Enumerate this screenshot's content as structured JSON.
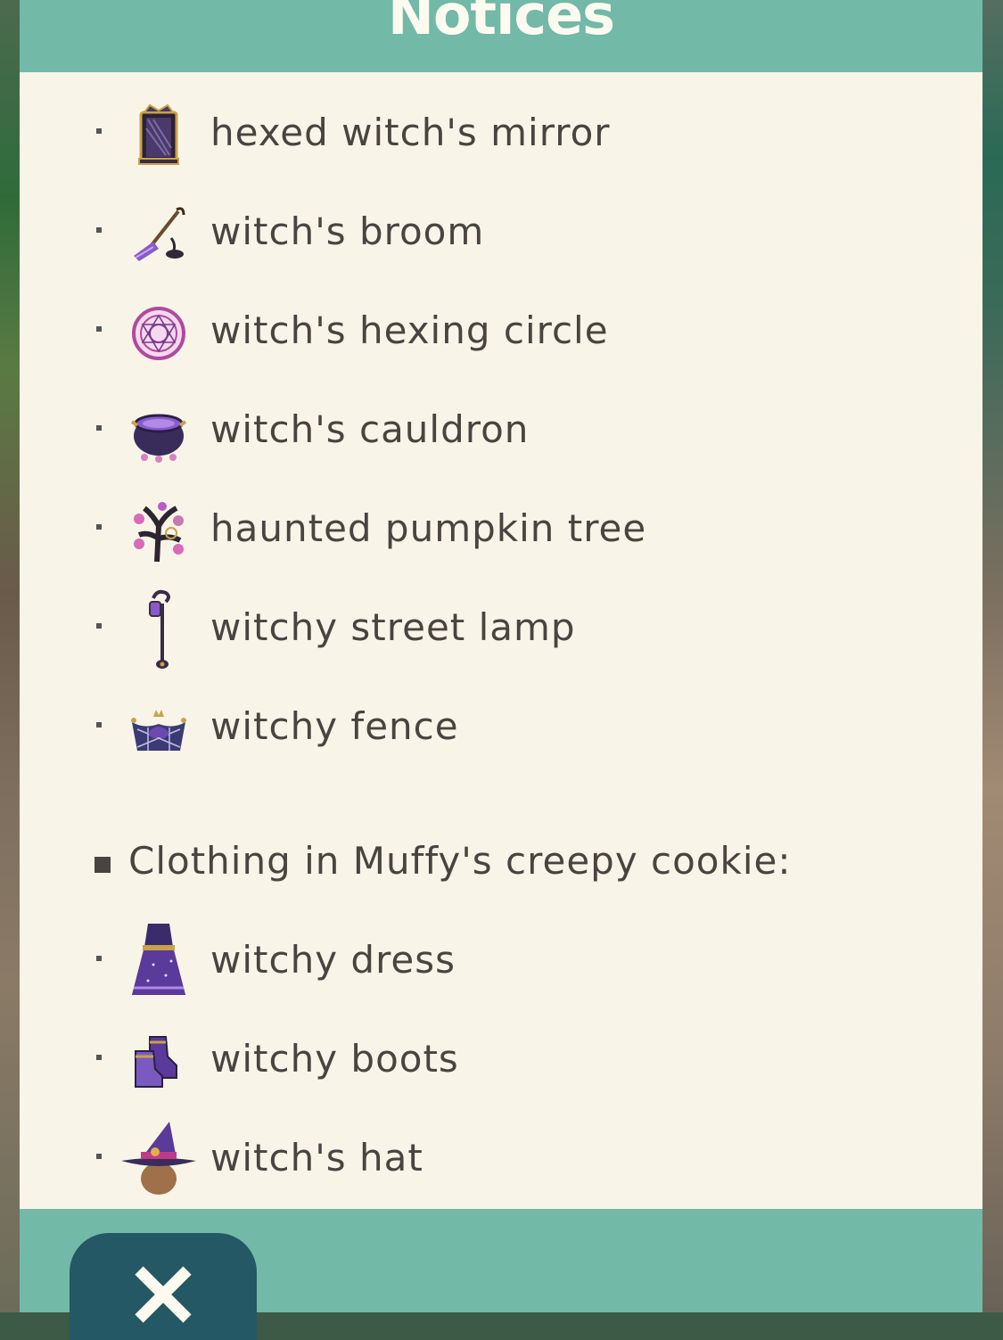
{
  "header": {
    "title": "Notices"
  },
  "furniture_items": [
    {
      "label": "hexed witch's mirror",
      "icon": "mirror-icon"
    },
    {
      "label": "witch's broom",
      "icon": "broom-icon"
    },
    {
      "label": "witch's hexing circle",
      "icon": "hexing-circle-icon"
    },
    {
      "label": "witch's cauldron",
      "icon": "cauldron-icon"
    },
    {
      "label": "haunted pumpkin tree",
      "icon": "pumpkin-tree-icon"
    },
    {
      "label": "witchy street lamp",
      "icon": "street-lamp-icon"
    },
    {
      "label": "witchy fence",
      "icon": "fence-icon"
    }
  ],
  "clothing_section": {
    "heading": "Clothing in Muffy's creepy cookie:"
  },
  "clothing_items": [
    {
      "label": "witchy dress",
      "icon": "dress-icon"
    },
    {
      "label": "witchy boots",
      "icon": "boots-icon"
    },
    {
      "label": "witch's hat",
      "icon": "hat-icon"
    }
  ],
  "footer": {
    "close_icon": "close-icon"
  },
  "colors": {
    "header_bg": "#72b9a7",
    "panel_bg": "#f8f5e8",
    "text": "#4a4440",
    "close_button_bg": "#245864"
  }
}
